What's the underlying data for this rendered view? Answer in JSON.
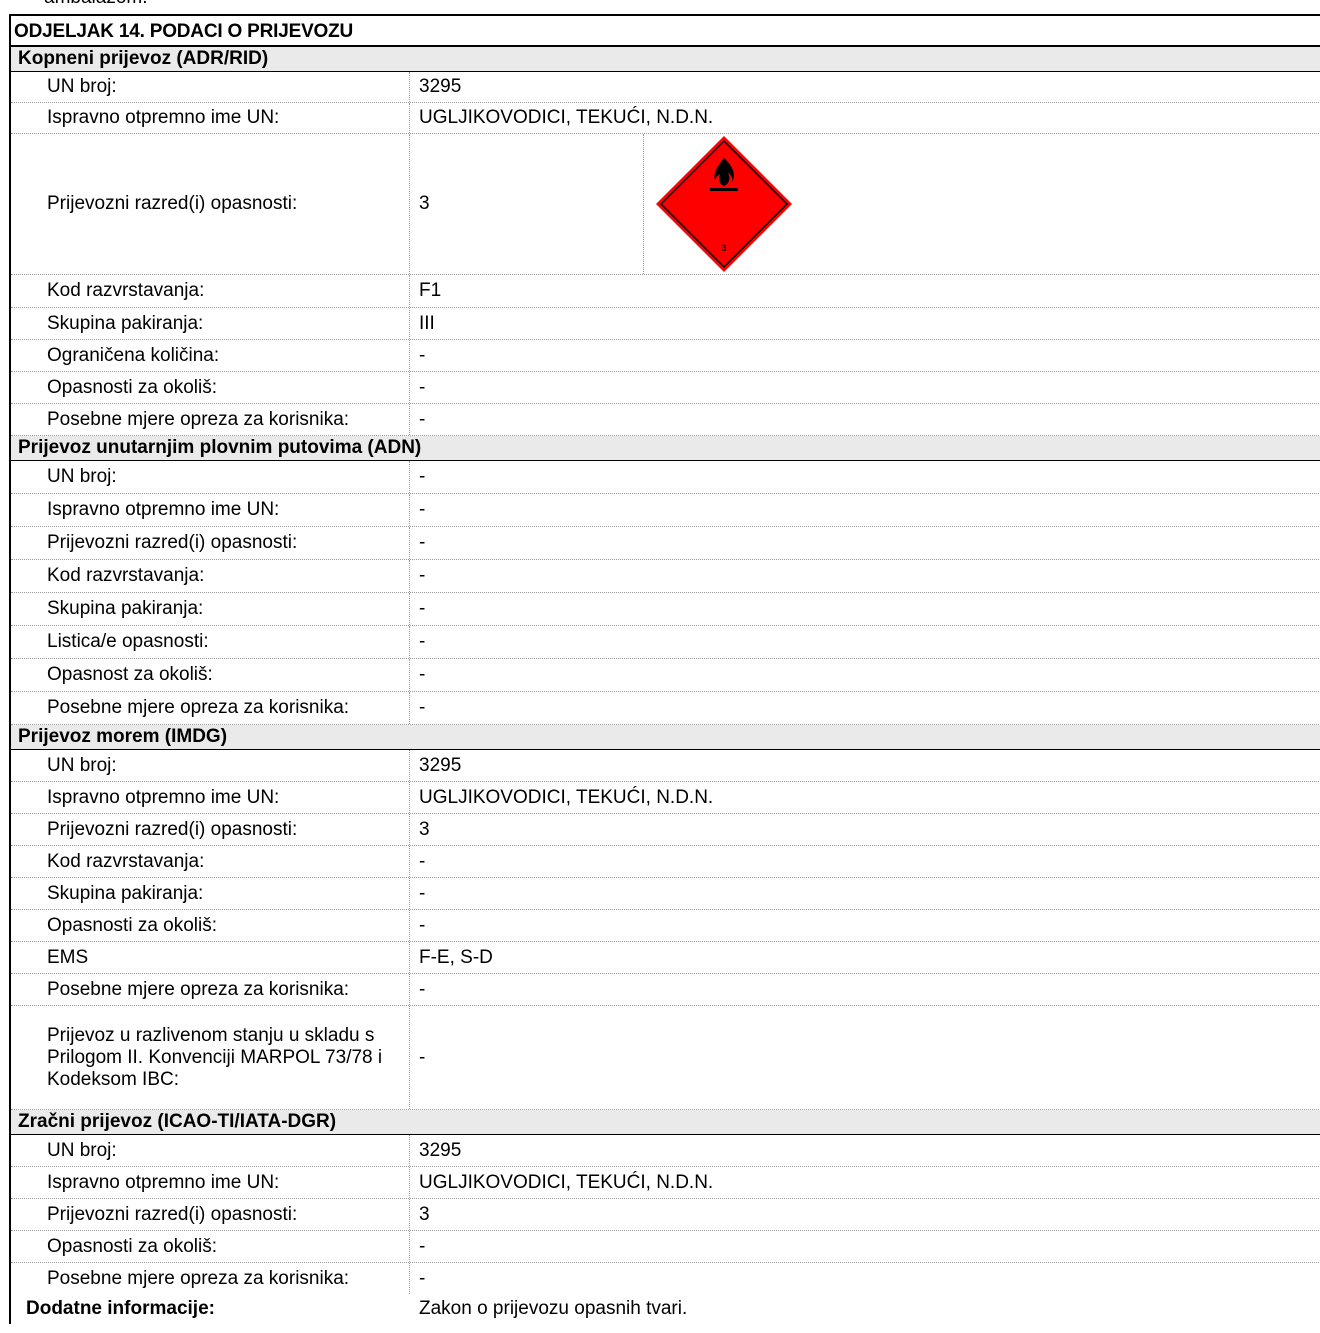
{
  "top_cut_text": "ambalažom.",
  "section_title": "ODJELJAK 14. PODACI O PRIJEVOZU",
  "groups": {
    "adr": {
      "title": "Kopneni prijevoz (ADR/RID)",
      "rows": [
        {
          "label": "UN broj:",
          "value": "3295"
        },
        {
          "label": "Ispravno otpremno ime UN:",
          "value": "UGLJIKOVODICI, TEKUĆI, N.D.N."
        },
        {
          "label": "Prijevozni razred(i) opasnosti:",
          "value": "3"
        },
        {
          "label": "Kod razvrstavanja:",
          "value": "F1"
        },
        {
          "label": "Skupina pakiranja:",
          "value": "III"
        },
        {
          "label": "Ograničena količina:",
          "value": "-"
        },
        {
          "label": "Opasnosti za okoliš:",
          "value": "-"
        },
        {
          "label": "Posebne mjere opreza za korisnika:",
          "value": "-"
        }
      ],
      "pictogram": {
        "icon": "flammable-liquid-hazard-icon",
        "class_number": "3",
        "color": "#ff0000"
      }
    },
    "adn": {
      "title": "Prijevoz unutarnjim plovnim putovima (ADN)",
      "rows": [
        {
          "label": "UN broj:",
          "value": "-"
        },
        {
          "label": "Ispravno otpremno ime UN:",
          "value": "-"
        },
        {
          "label": "Prijevozni razred(i) opasnosti:",
          "value": "-"
        },
        {
          "label": "Kod razvrstavanja:",
          "value": "-"
        },
        {
          "label": "Skupina pakiranja:",
          "value": "-"
        },
        {
          "label": "Listica/e opasnosti:",
          "value": "-"
        },
        {
          "label": "Opasnost za okoliš:",
          "value": "-"
        },
        {
          "label": "Posebne mjere opreza za korisnika:",
          "value": "-"
        }
      ]
    },
    "imdg": {
      "title": "Prijevoz morem (IMDG)",
      "rows": [
        {
          "label": "UN broj:",
          "value": "3295"
        },
        {
          "label": "Ispravno otpremno ime UN:",
          "value": "UGLJIKOVODICI, TEKUĆI, N.D.N."
        },
        {
          "label": "Prijevozni razred(i) opasnosti:",
          "value": "3"
        },
        {
          "label": "Kod razvrstavanja:",
          "value": "-"
        },
        {
          "label": "Skupina pakiranja:",
          "value": "-"
        },
        {
          "label": "Opasnosti za okoliš:",
          "value": "-"
        },
        {
          "label": "EMS",
          "value": "F-E, S-D"
        },
        {
          "label": "Posebne mjere opreza za korisnika:",
          "value": "-"
        },
        {
          "label": "Prijevoz u razlivenom stanju u skladu s Prilogom II. Konvenciji MARPOL 73/78 i Kodeksom IBC:",
          "value": "-"
        }
      ]
    },
    "iata": {
      "title": "Zračni prijevoz (ICAO-TI/IATA-DGR)",
      "rows": [
        {
          "label": "UN broj:",
          "value": "3295"
        },
        {
          "label": "Ispravno otpremno ime UN:",
          "value": "UGLJIKOVODICI, TEKUĆI, N.D.N."
        },
        {
          "label": "Prijevozni razred(i) opasnosti:",
          "value": "3"
        },
        {
          "label": "Opasnosti za okoliš:",
          "value": "-"
        },
        {
          "label": "Posebne mjere opreza za korisnika:",
          "value": "-"
        }
      ]
    }
  },
  "additional": {
    "label": "Dodatne informacije:",
    "value": "Zakon o prijevozu opasnih tvari."
  }
}
